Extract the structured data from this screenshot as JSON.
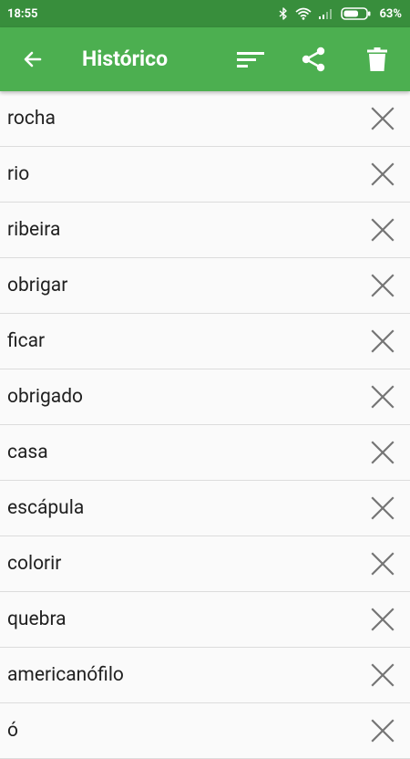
{
  "status_bar": {
    "time": "18:55",
    "battery": "63%",
    "icons": [
      "bluetooth-icon",
      "wifi-icon",
      "signal-icon",
      "battery-icon"
    ]
  },
  "app_bar": {
    "title": "Histórico",
    "actions": [
      "back-arrow-icon",
      "sort-icon",
      "share-icon",
      "delete-icon"
    ]
  },
  "colors": {
    "status_bar": "#388e3c",
    "app_bar": "#4caf50",
    "list_background": "#fafafa",
    "divider": "#dcdcdc",
    "text": "#212121",
    "remove_icon": "#757575"
  },
  "history": {
    "items": [
      "rocha",
      "rio",
      "ribeira",
      "obrigar",
      "ficar",
      "obrigado",
      "casa",
      "escápula",
      "colorir",
      "quebra",
      "americanófilo",
      "ó"
    ]
  }
}
